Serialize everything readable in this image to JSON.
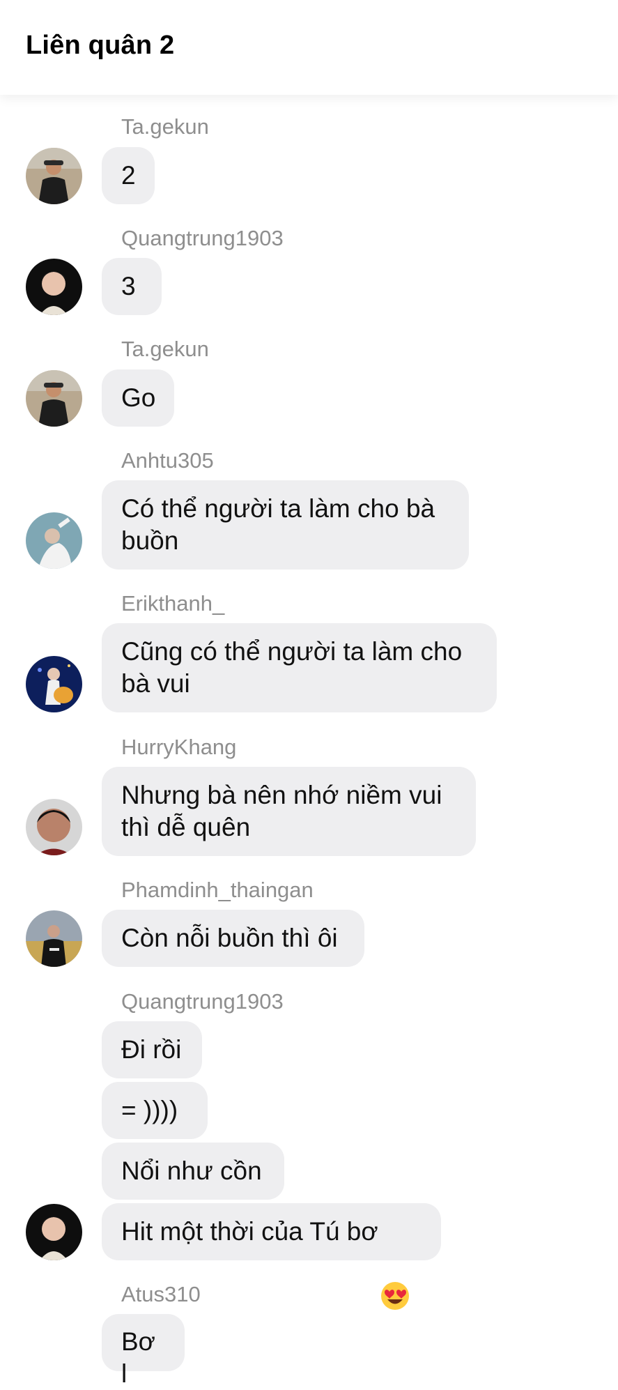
{
  "header": {
    "title": "Liên quân 2"
  },
  "messages": [
    {
      "sender": "Ta.gekun",
      "text": "2"
    },
    {
      "sender": "Quangtrung1903",
      "text": "3"
    },
    {
      "sender": "Ta.gekun",
      "text": "Go"
    },
    {
      "sender": "Anhtu305",
      "text": "Có thể người ta làm cho bà\nbuồn"
    },
    {
      "sender": "Erikthanh_",
      "text": "Cũng có thể người ta làm cho\nbà vui"
    },
    {
      "sender": "HurryKhang",
      "text": "Nhưng bà nên nhớ niềm vui\nthì dễ quên"
    },
    {
      "sender": "Phamdinh_thaingan",
      "text": "Còn nỗi buồn thì ôi"
    },
    {
      "sender": "Quangtrung1903",
      "texts": [
        "Đi rồi",
        "= ))))",
        "Nổi như cồn",
        "Hit một thời của Tú bơ"
      ]
    },
    {
      "sender": "Atus310",
      "text": "Bơ l"
    }
  ],
  "emojis": {
    "heart_eyes": "heart-eyes-emoji"
  },
  "colors": {
    "bubble_bg": "#eeeef0",
    "sender_text": "#8e8e8e",
    "header_bg": "#ffffff"
  }
}
